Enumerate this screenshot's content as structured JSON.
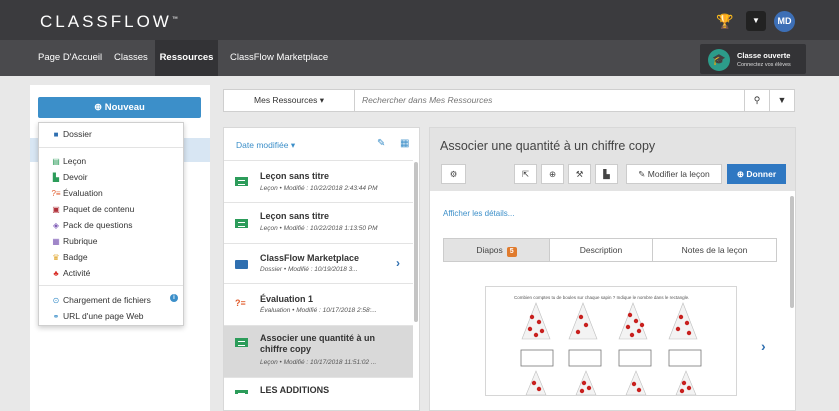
{
  "app": {
    "logo": "CLASSFLOW",
    "logo_mark": "™",
    "avatar_initials": "MD"
  },
  "nav": {
    "items": [
      {
        "label": "Page D'Accueil"
      },
      {
        "label": "Classes"
      },
      {
        "label": "Ressources"
      },
      {
        "label": "ClassFlow Marketplace"
      }
    ],
    "active": "Ressources",
    "live": {
      "title": "Classe ouverte",
      "subtitle": "Connectez vos élèves"
    }
  },
  "sidebar": {
    "new_button": "Nouveau",
    "menu": {
      "group1": [
        {
          "label": "Dossier",
          "icon": "folder-icon"
        }
      ],
      "group2": [
        {
          "label": "Leçon",
          "icon": "lesson-icon"
        },
        {
          "label": "Devoir",
          "icon": "assignment-icon"
        },
        {
          "label": "Évaluation",
          "icon": "assessment-icon"
        },
        {
          "label": "Paquet de contenu",
          "icon": "content-package-icon"
        },
        {
          "label": "Pack de questions",
          "icon": "question-pack-icon"
        },
        {
          "label": "Rubrique",
          "icon": "rubric-icon"
        },
        {
          "label": "Badge",
          "icon": "badge-icon"
        },
        {
          "label": "Activité",
          "icon": "activity-icon"
        }
      ],
      "group3": [
        {
          "label": "Chargement de fichiers",
          "icon": "upload-icon"
        },
        {
          "label": "URL d'une page Web",
          "icon": "link-icon"
        }
      ]
    }
  },
  "search": {
    "scope": "Mes Ressources",
    "placeholder": "Rechercher dans Mes Ressources"
  },
  "list": {
    "sort_label": "Date modifiée",
    "items": [
      {
        "title": "Leçon sans titre",
        "type": "Leçon",
        "meta": "Modifié : 10/22/2018 2:43:44 PM",
        "kind": "lesson"
      },
      {
        "title": "Leçon sans titre",
        "type": "Leçon",
        "meta": "Modifié : 10/22/2018 1:13:50 PM",
        "kind": "lesson"
      },
      {
        "title": "ClassFlow Marketplace",
        "type": "Dossier",
        "meta": "Modifié : 10/19/2018 3...",
        "kind": "folder"
      },
      {
        "title": "Évaluation 1",
        "type": "Évaluation",
        "meta": "Modifié : 10/17/2018 2:58:...",
        "kind": "eval"
      },
      {
        "title": "Associer une quantité à un chiffre copy",
        "type": "Leçon",
        "meta": "Modifié : 10/17/2018 11:51:02 ...",
        "kind": "lesson"
      },
      {
        "title": "LES ADDITIONS",
        "type": "",
        "meta": "",
        "kind": "lesson"
      }
    ]
  },
  "detail": {
    "title": "Associer une quantité à un chiffre copy",
    "modify_label": "Modifier la leçon",
    "give_label": "Donner",
    "details_link": "Afficher les détails...",
    "tabs": [
      {
        "label": "Diapos",
        "count": "5"
      },
      {
        "label": "Description"
      },
      {
        "label": "Notes de la leçon"
      }
    ],
    "slide_caption": "Combien comptes tu de boules sur chaque sapin ? Indique le nombre dans le rectangle."
  },
  "colors": {
    "accent": "#3c8fc9",
    "primary": "#2f78c2",
    "topbar": "#3b3b3e",
    "badge": "#e07b2e"
  }
}
